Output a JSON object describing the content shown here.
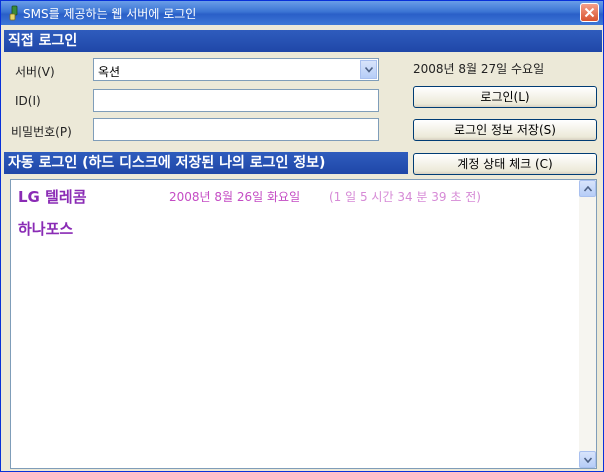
{
  "window": {
    "title": "SMS를 제공하는 웹 서버에 로그인"
  },
  "direct_login": {
    "header": "직접 로그인",
    "server_label": "서버(V)",
    "server_value": "옥션",
    "id_label": "ID(I)",
    "id_value": "",
    "password_label": "비밀번호(P)",
    "password_value": "",
    "date": "2008년 8월 27일 수요일",
    "login_button": "로그인(L)",
    "save_button": "로그인 정보 저장(S)"
  },
  "auto_login": {
    "header": "자동 로그인 (하드 디스크에 저장된 나의 로그인 정보)",
    "check_button": "계정 상태 체크 (C)",
    "entries": [
      {
        "name": "LG 텔레콤",
        "date": "2008년 8월 26일 화요일",
        "elapsed": "(1 일 5 시간 34 분 39 초  전)"
      },
      {
        "name": "하나포스",
        "date": "",
        "elapsed": ""
      }
    ]
  },
  "colors": {
    "title_bar": "#3b74d4",
    "section_bar": "#2f5cbd",
    "entry_name": "#8a2bb5",
    "entry_date": "#c44cc4"
  },
  "icons": [
    "app-icon",
    "close-icon",
    "dropdown-arrow-icon",
    "scroll-up-icon",
    "scroll-down-icon"
  ]
}
